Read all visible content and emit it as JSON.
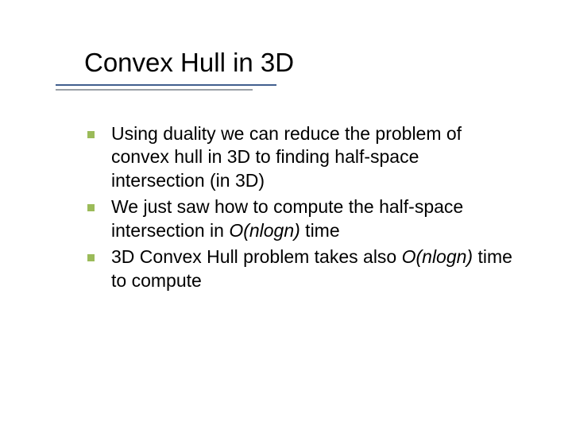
{
  "slide": {
    "title": "Convex Hull in 3D",
    "bullets": [
      {
        "pre": "Using duality we can reduce the problem of convex hull in 3D to finding half-space intersection (in 3D)",
        "ital": "",
        "post": ""
      },
      {
        "pre": "We just saw how to compute the half-space intersection in ",
        "ital": "O(nlogn)",
        "post": " time"
      },
      {
        "pre": "3D Convex Hull problem takes also ",
        "ital": "O(nlogn)",
        "post": " time to compute"
      }
    ]
  }
}
